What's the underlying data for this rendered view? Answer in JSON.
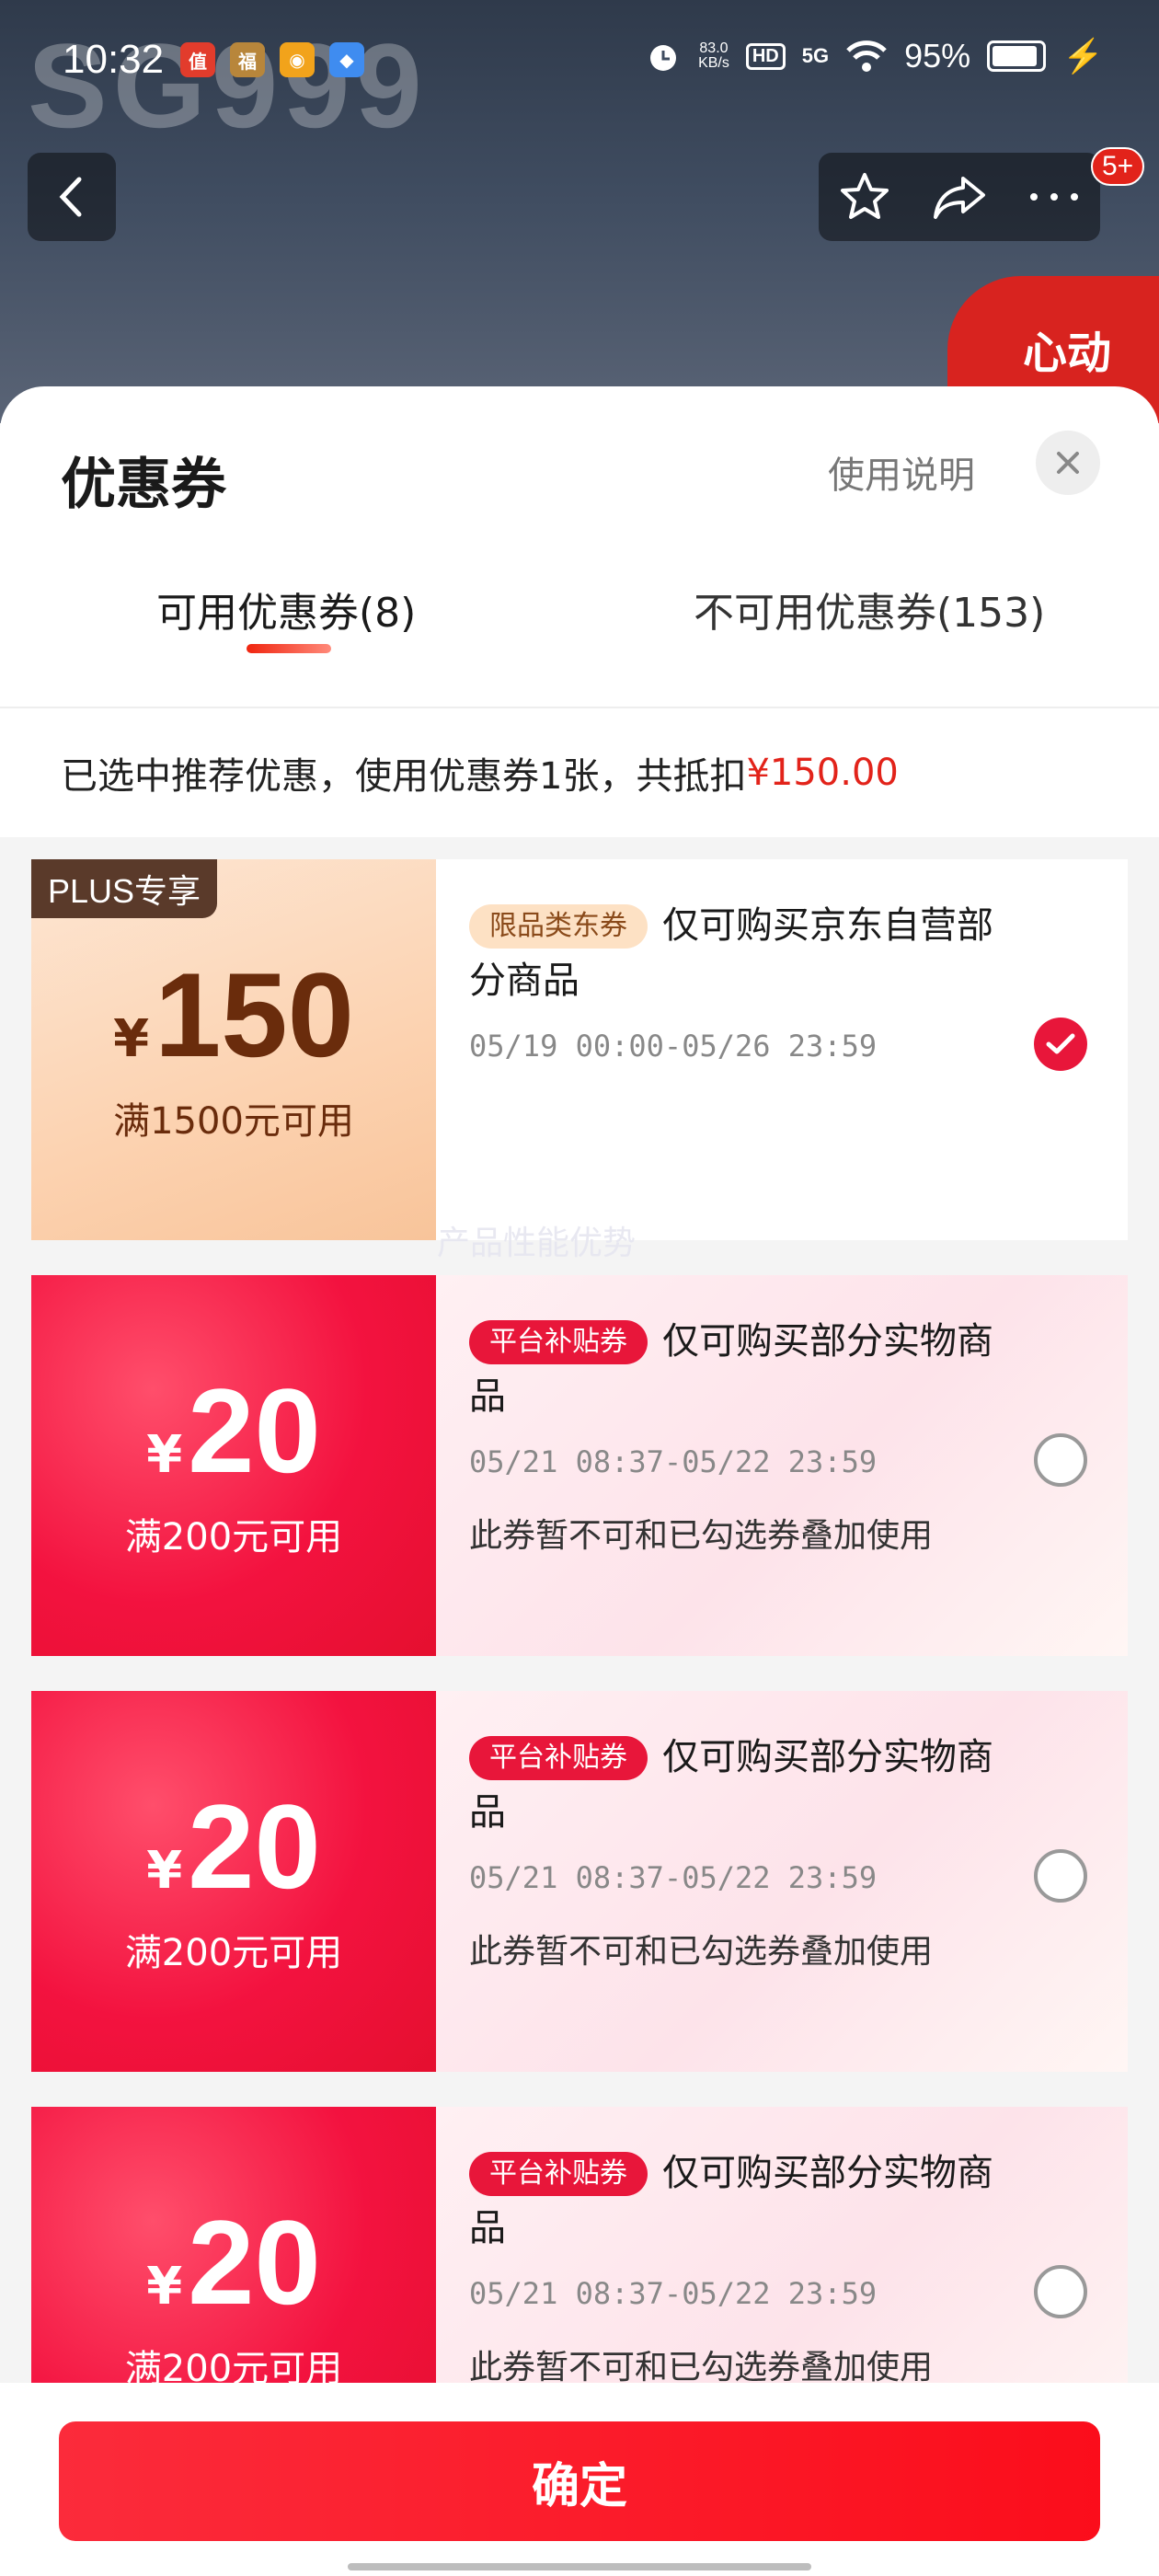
{
  "status_bar": {
    "time": "10:32",
    "net_speed_value": "83.0",
    "net_speed_unit": "KB/s",
    "hd": "HD",
    "network": "5G",
    "battery": "95%"
  },
  "background": {
    "watermark": "SG999",
    "cart_badge": "5+",
    "promo_text": "心动"
  },
  "sheet": {
    "title": "优惠券",
    "help_label": "使用说明",
    "tabs": [
      {
        "label": "可用优惠券(8)"
      },
      {
        "label": "不可用优惠券(153)"
      }
    ],
    "summary_text": "已选中推荐优惠，使用优惠券1张，共抵扣",
    "summary_amount": "¥150.00"
  },
  "coupons": [
    {
      "corner_tag": "PLUS专享",
      "currency": "¥",
      "amount": "150",
      "condition": "满1500元可用",
      "tag": "限品类东券",
      "title": "仅可购买京东自营部分商品",
      "validity": "05/19 00:00-05/26 23:59",
      "note": "",
      "selected": true
    },
    {
      "currency": "¥",
      "amount": "20",
      "condition": "满200元可用",
      "tag": "平台补贴券",
      "title": "仅可购买部分实物商品",
      "validity": "05/21 08:37-05/22 23:59",
      "note": "此券暂不可和已勾选券叠加使用",
      "selected": false
    },
    {
      "currency": "¥",
      "amount": "20",
      "condition": "满200元可用",
      "tag": "平台补贴券",
      "title": "仅可购买部分实物商品",
      "validity": "05/21 08:37-05/22 23:59",
      "note": "此券暂不可和已勾选券叠加使用",
      "selected": false
    },
    {
      "currency": "¥",
      "amount": "20",
      "condition": "满200元可用",
      "tag": "平台补贴券",
      "title": "仅可购买部分实物商品",
      "validity": "05/21 08:37-05/22 23:59",
      "note": "此券暂不可和已勾选券叠加使用",
      "selected": false
    }
  ],
  "overlay_text": "产品性能优势",
  "footer": {
    "confirm_label": "确定"
  },
  "colors": {
    "accent": "#e2231a",
    "confirm": "#fb1a2a",
    "plus_coupon": "#fcd2b0",
    "subsidy_coupon": "#f3123f"
  }
}
